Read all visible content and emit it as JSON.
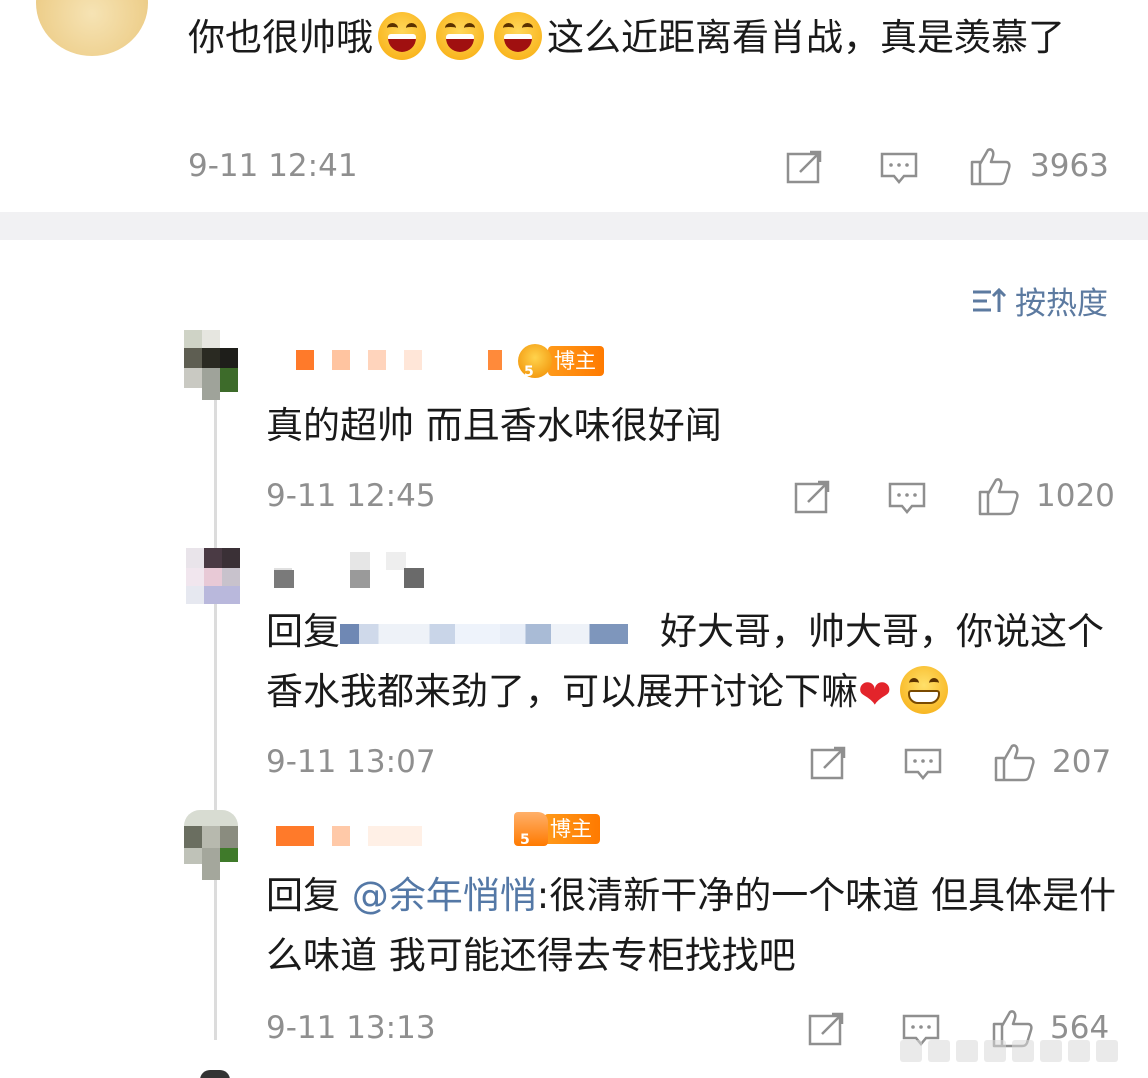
{
  "top_comment": {
    "text_before": "你也很帅哦",
    "emojis": [
      "laughing-emoji",
      "laughing-emoji",
      "laughing-emoji"
    ],
    "text_after": "这么近距离看肖战，真是羡慕了",
    "time": "9-11 12:41",
    "likes": "3963"
  },
  "sort": {
    "label": "按热度",
    "icon": "sort-icon"
  },
  "replies": [
    {
      "badge": "博主",
      "text": "真的超帅 而且香水味很好闻",
      "time": "9-11 12:45",
      "likes": "1020"
    },
    {
      "reply_prefix": "回复",
      "text": "好大哥，帅大哥，你说这个香水我都来劲了，可以展开讨论下嘛",
      "emojis": [
        "heart-emoji",
        "grin-emoji"
      ],
      "time": "9-11 13:07",
      "likes": "207"
    },
    {
      "badge": "博主",
      "reply_prefix": "回复",
      "mention": "@余年悄悄",
      "text": ":很清新干净的一个味道 但具体是什么味道 我可能还得去专柜找找吧",
      "time": "9-11 13:13",
      "likes": "564"
    }
  ],
  "colors": {
    "meta_gray": "#8f8f8f",
    "link_blue": "#5478a6",
    "badge_orange": "#ff8a00",
    "divider": "#f1f1f3"
  }
}
